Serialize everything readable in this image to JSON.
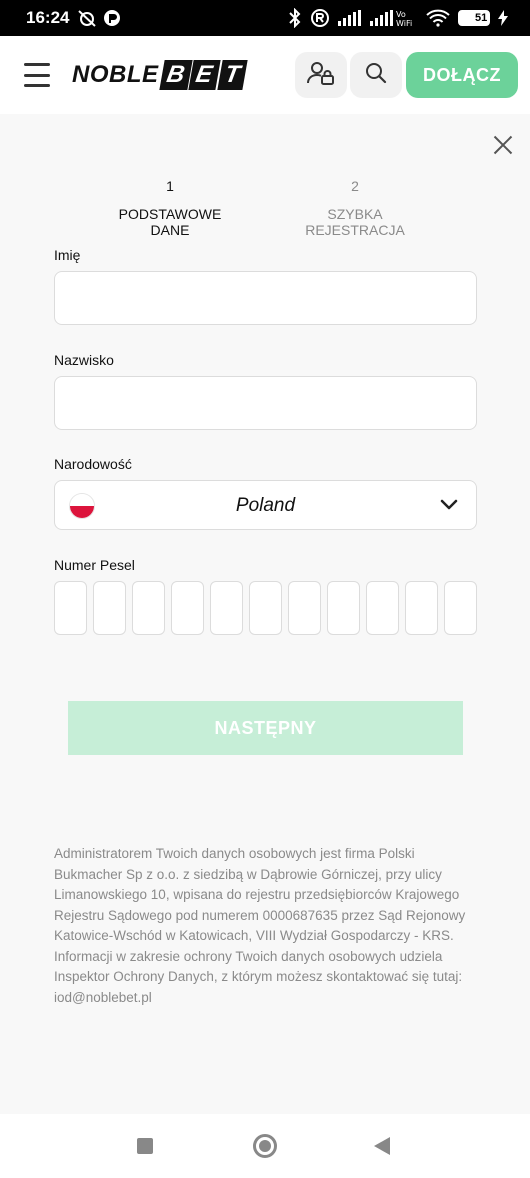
{
  "status_bar": {
    "time": "16:24",
    "battery": "51"
  },
  "header": {
    "logo_part1": "NOBLE",
    "logo_part2": [
      "B",
      "E",
      "T"
    ],
    "join_label": "DOŁĄCZ"
  },
  "steps": [
    {
      "number": "1",
      "label": "PODSTAWOWE DANE",
      "active": true
    },
    {
      "number": "2",
      "label": "SZYBKA REJESTRACJA",
      "active": false
    }
  ],
  "form": {
    "first_name_label": "Imię",
    "first_name_value": "",
    "last_name_label": "Nazwisko",
    "last_name_value": "",
    "nationality_label": "Narodowość",
    "nationality_value": "Poland",
    "pesel_label": "Numer Pesel",
    "pesel_digits": 11,
    "next_label": "NASTĘPNY"
  },
  "legal_text": "Administratorem Twoich danych osobowych jest firma Polski Bukmacher Sp z o.o. z siedzibą w Dąbrowie Górniczej, przy ulicy Limanowskiego 10, wpisana do rejestru przedsiębiorców Krajowego Rejestru Sądowego pod numerem 0000687635 przez Sąd Rejonowy Katowice-Wschód w Katowicach, VIII Wydział Gospodarczy - KRS. Informacji w zakresie ochrony Twoich danych osobowych udziela Inspektor Ochrony Danych, z którym możesz skontaktować się tutaj: iod@noblebet.pl",
  "colors": {
    "accent": "#6cd29a",
    "accent_disabled": "#c6eed7",
    "modal_bg": "#f8f8f8"
  }
}
